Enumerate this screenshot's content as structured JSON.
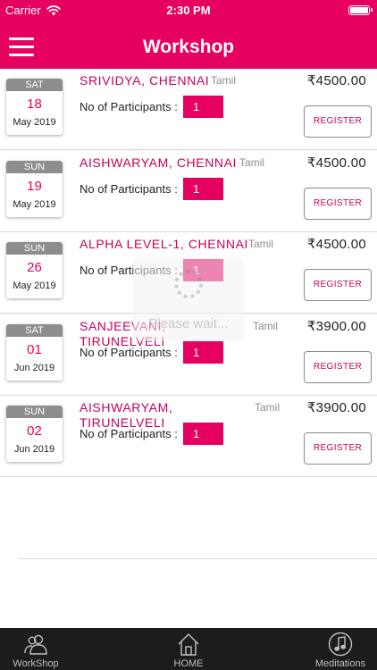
{
  "status_bar": {
    "carrier": "Carrier",
    "time": "2:30 PM"
  },
  "header": {
    "title": "Workshop"
  },
  "events": [
    {
      "dow": "SAT",
      "day": "18",
      "month": "May 2019",
      "name": "SRIVIDYA, CHENNAI",
      "language": "Tamil",
      "price": "₹4500.00",
      "participants_label": "No of Participants :",
      "participants": "1",
      "register": "REGISTER"
    },
    {
      "dow": "SUN",
      "day": "19",
      "month": "May 2019",
      "name": "AISHWARYAM, CHENNAI",
      "language": "Tamil",
      "price": "₹4500.00",
      "participants_label": "No of Participants :",
      "participants": "1",
      "register": "REGISTER"
    },
    {
      "dow": "SUN",
      "day": "26",
      "month": "May 2019",
      "name": "ALPHA LEVEL-1, CHENNAI",
      "language": "Tamil",
      "price": "₹4500.00",
      "participants_label": "No of Participants :",
      "participants": "1",
      "register": "REGISTER"
    },
    {
      "dow": "SAT",
      "day": "01",
      "month": "Jun 2019",
      "name": "SANJEEVANI, TIRUNELVELI",
      "language": "Tamil",
      "price": "₹3900.00",
      "participants_label": "No of Participants :",
      "participants": "1",
      "register": "REGISTER"
    },
    {
      "dow": "SUN",
      "day": "02",
      "month": "Jun 2019",
      "name": "AISHWARYAM, TIRUNELVELI",
      "language": "Tamil",
      "price": "₹3900.00",
      "participants_label": "No of Participants :",
      "participants": "1",
      "register": "REGISTER"
    }
  ],
  "loader": {
    "text": "Please wait..."
  },
  "tabbar": {
    "items": [
      {
        "label": "WorkShop",
        "icon": "users-icon"
      },
      {
        "label": "HOME",
        "icon": "home-icon"
      },
      {
        "label": "Meditations",
        "icon": "music-note-icon"
      }
    ]
  },
  "colors": {
    "accent": "#e6005f",
    "tabbar": "#1c1c1c"
  }
}
